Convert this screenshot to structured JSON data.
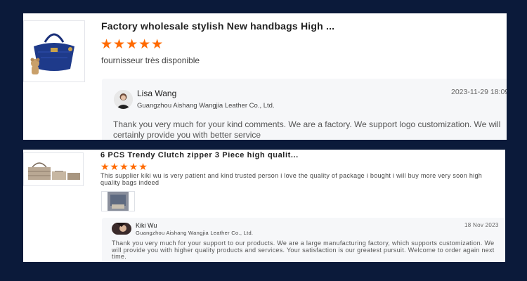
{
  "colors": {
    "background": "#0b1a3a",
    "card": "#ffffff",
    "reply_bg": "#f6f7f9",
    "star": "#ff6a00"
  },
  "reviews": [
    {
      "product_title": "Factory wholesale stylish New handbags High ...",
      "stars": "★★★★★",
      "rating": 5,
      "review_text": "fournisseur très disponible",
      "thumb_icon": "handbag-image",
      "reply": {
        "name": "Lisa Wang",
        "company": "Guangzhou Aishang Wangjia Leather Co., Ltd.",
        "date": "2023-11-29 18:09",
        "text": "Thank you very much for your kind comments. We are a factory. We support logo customization. We will certainly provide you with better service"
      }
    },
    {
      "product_title": "6 PCS Trendy Clutch zipper 3 Piece high qualit...",
      "stars": "★★★★★",
      "rating": 5,
      "review_text": "This supplier kiki wu is very patient and kind trusted person i love the quality of package i bought i will buy more very soon high quality bags indeed",
      "thumb_icon": "handbag-set-image",
      "photo_icon": "review-photo",
      "reply": {
        "name": "Kiki Wu",
        "company": "Guangzhou Aishang Wangjia Leather Co., Ltd.",
        "date": "18 Nov 2023",
        "text": "Thank you very much for your support to our products. We are a large manufacturing factory, which supports customization. We will provide you with higher quality products and services. Your satisfaction is our greatest pursuit. Welcome to order again next time."
      }
    }
  ]
}
